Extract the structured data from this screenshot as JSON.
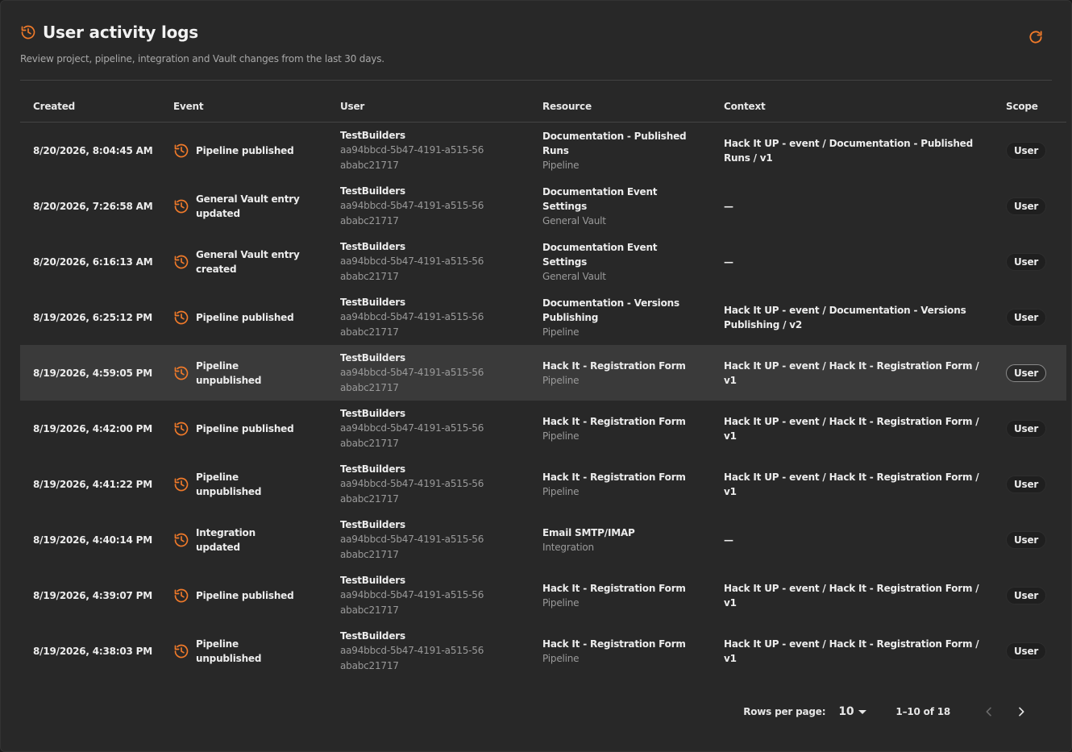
{
  "header": {
    "title": "User activity logs",
    "subtitle": "Review project, pipeline, integration and Vault changes from the last 30 days.",
    "icon": "history-icon",
    "refresh_icon": "refresh-icon",
    "accent_color": "#f07a2a"
  },
  "table": {
    "columns": [
      "Created",
      "Event",
      "User",
      "Resource",
      "Context",
      "Scope"
    ],
    "rows": [
      {
        "created": "8/20/2026, 8:04:45 AM",
        "event": "Pipeline published",
        "user_name": "TestBuilders",
        "user_id": "aa94bbcd-5b47-4191-a515-56ababc21717",
        "resource_name": "Documentation - Published Runs",
        "resource_type": "Pipeline",
        "context": "Hack It UP - event / Documentation - Published Runs / v1",
        "scope": "User"
      },
      {
        "created": "8/20/2026, 7:26:58 AM",
        "event": "General Vault entry updated",
        "user_name": "TestBuilders",
        "user_id": "aa94bbcd-5b47-4191-a515-56ababc21717",
        "resource_name": "Documentation Event Settings",
        "resource_type": "General Vault",
        "context": "—",
        "scope": "User"
      },
      {
        "created": "8/20/2026, 6:16:13 AM",
        "event": "General Vault entry created",
        "user_name": "TestBuilders",
        "user_id": "aa94bbcd-5b47-4191-a515-56ababc21717",
        "resource_name": "Documentation Event Settings",
        "resource_type": "General Vault",
        "context": "—",
        "scope": "User"
      },
      {
        "created": "8/19/2026, 6:25:12 PM",
        "event": "Pipeline published",
        "user_name": "TestBuilders",
        "user_id": "aa94bbcd-5b47-4191-a515-56ababc21717",
        "resource_name": "Documentation - Versions Publishing",
        "resource_type": "Pipeline",
        "context": "Hack It UP - event / Documentation - Versions Publishing / v2",
        "scope": "User"
      },
      {
        "created": "8/19/2026, 4:59:05 PM",
        "event": "Pipeline unpublished",
        "user_name": "TestBuilders",
        "user_id": "aa94bbcd-5b47-4191-a515-56ababc21717",
        "resource_name": "Hack It - Registration Form",
        "resource_type": "Pipeline",
        "context": "Hack It UP - event / Hack It - Registration Form / v1",
        "scope": "User",
        "highlighted": true
      },
      {
        "created": "8/19/2026, 4:42:00 PM",
        "event": "Pipeline published",
        "user_name": "TestBuilders",
        "user_id": "aa94bbcd-5b47-4191-a515-56ababc21717",
        "resource_name": "Hack It - Registration Form",
        "resource_type": "Pipeline",
        "context": "Hack It UP - event / Hack It - Registration Form / v1",
        "scope": "User"
      },
      {
        "created": "8/19/2026, 4:41:22 PM",
        "event": "Pipeline unpublished",
        "user_name": "TestBuilders",
        "user_id": "aa94bbcd-5b47-4191-a515-56ababc21717",
        "resource_name": "Hack It - Registration Form",
        "resource_type": "Pipeline",
        "context": "Hack It UP - event / Hack It - Registration Form / v1",
        "scope": "User"
      },
      {
        "created": "8/19/2026, 4:40:14 PM",
        "event": "Integration updated",
        "user_name": "TestBuilders",
        "user_id": "aa94bbcd-5b47-4191-a515-56ababc21717",
        "resource_name": "Email SMTP/IMAP",
        "resource_type": "Integration",
        "context": "—",
        "scope": "User"
      },
      {
        "created": "8/19/2026, 4:39:07 PM",
        "event": "Pipeline published",
        "user_name": "TestBuilders",
        "user_id": "aa94bbcd-5b47-4191-a515-56ababc21717",
        "resource_name": "Hack It - Registration Form",
        "resource_type": "Pipeline",
        "context": "Hack It UP - event / Hack It - Registration Form / v1",
        "scope": "User"
      },
      {
        "created": "8/19/2026, 4:38:03 PM",
        "event": "Pipeline unpublished",
        "user_name": "TestBuilders",
        "user_id": "aa94bbcd-5b47-4191-a515-56ababc21717",
        "resource_name": "Hack It - Registration Form",
        "resource_type": "Pipeline",
        "context": "Hack It UP - event / Hack It - Registration Form / v1",
        "scope": "User"
      }
    ]
  },
  "pagination": {
    "rows_per_page_label": "Rows per page:",
    "rows_per_page_value": "10",
    "range_label": "1–10 of 18",
    "prev_icon": "chevron-left-icon",
    "next_icon": "chevron-right-icon"
  }
}
